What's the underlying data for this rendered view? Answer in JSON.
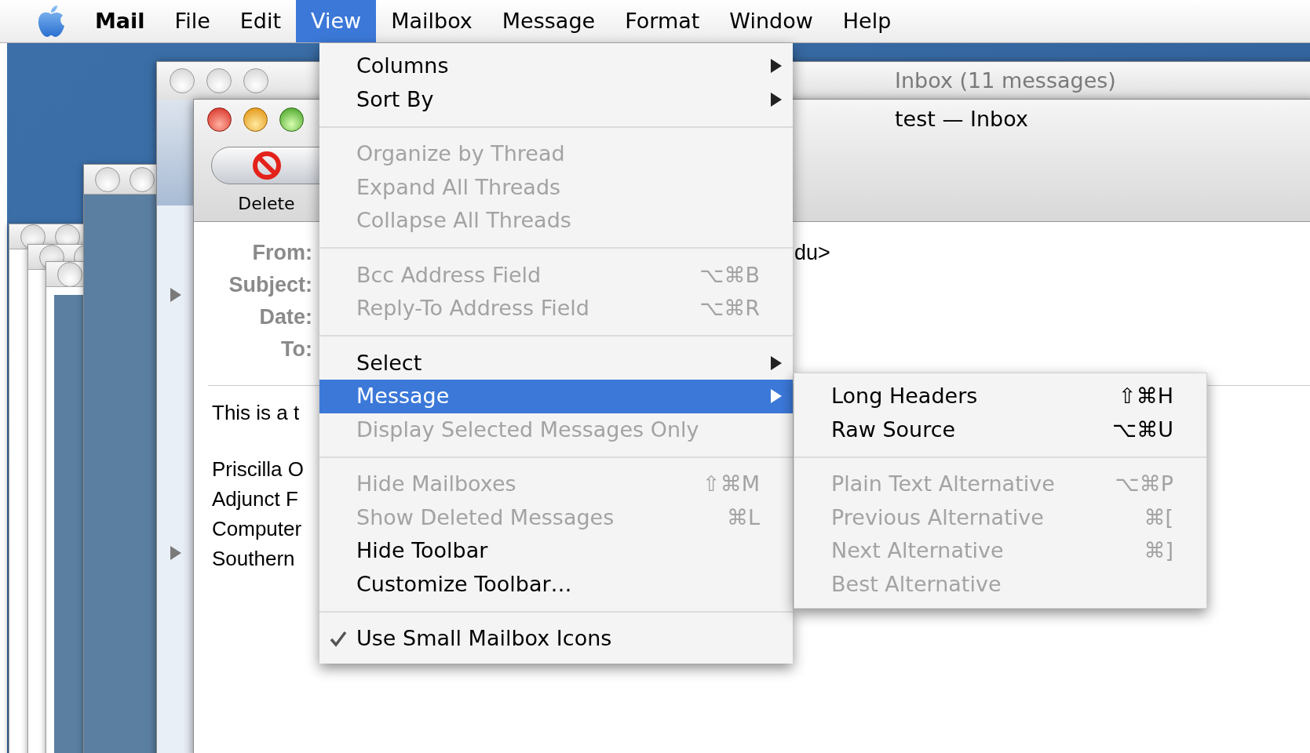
{
  "menu_bar": {
    "items": [
      {
        "label": "Mail",
        "bold": true,
        "selected": false
      },
      {
        "label": "File",
        "bold": false,
        "selected": false
      },
      {
        "label": "Edit",
        "bold": false,
        "selected": false
      },
      {
        "label": "View",
        "bold": false,
        "selected": true
      },
      {
        "label": "Mailbox",
        "bold": false,
        "selected": false
      },
      {
        "label": "Message",
        "bold": false,
        "selected": false
      },
      {
        "label": "Format",
        "bold": false,
        "selected": false
      },
      {
        "label": "Window",
        "bold": false,
        "selected": false
      },
      {
        "label": "Help",
        "bold": false,
        "selected": false
      }
    ]
  },
  "inbox_window": {
    "title": "Inbox (11 messages)"
  },
  "message_window": {
    "title": "test — Inbox",
    "toolbar": [
      {
        "label": "Delete"
      }
    ],
    "headers": [
      {
        "label": "From:",
        "value": "du>"
      },
      {
        "label": "Subject:"
      },
      {
        "label": "Date:"
      },
      {
        "label": "To:"
      }
    ],
    "body": [
      [
        "This is a t"
      ],
      [
        "Priscilla O",
        "Adjunct F",
        "Computer",
        "Southern"
      ]
    ]
  },
  "view_menu": {
    "items": [
      {
        "kind": "item",
        "label": "Columns",
        "disabled": false,
        "submenu": true,
        "checked": false,
        "selected": false
      },
      {
        "kind": "item",
        "label": "Sort By",
        "disabled": false,
        "submenu": true,
        "checked": false,
        "selected": false
      },
      {
        "kind": "separator"
      },
      {
        "kind": "item",
        "label": "Organize by Thread",
        "disabled": true,
        "submenu": false,
        "checked": false,
        "selected": false
      },
      {
        "kind": "item",
        "label": "Expand All Threads",
        "disabled": true,
        "submenu": false,
        "checked": false,
        "selected": false
      },
      {
        "kind": "item",
        "label": "Collapse All Threads",
        "disabled": true,
        "submenu": false,
        "checked": false,
        "selected": false
      },
      {
        "kind": "separator"
      },
      {
        "kind": "item",
        "label": "Bcc Address Field",
        "shortcut": "⌥⌘B",
        "disabled": true,
        "submenu": false,
        "checked": false,
        "selected": false
      },
      {
        "kind": "item",
        "label": "Reply-To Address Field",
        "shortcut": "⌥⌘R",
        "disabled": true,
        "submenu": false,
        "checked": false,
        "selected": false
      },
      {
        "kind": "separator"
      },
      {
        "kind": "item",
        "label": "Select",
        "disabled": false,
        "submenu": true,
        "checked": false,
        "selected": false
      },
      {
        "kind": "item",
        "label": "Message",
        "disabled": false,
        "submenu": true,
        "checked": false,
        "selected": true
      },
      {
        "kind": "item",
        "label": "Display Selected Messages Only",
        "disabled": true,
        "submenu": false,
        "checked": false,
        "selected": false
      },
      {
        "kind": "separator"
      },
      {
        "kind": "item",
        "label": "Hide Mailboxes",
        "shortcut": "⇧⌘M",
        "disabled": true,
        "submenu": false,
        "checked": false,
        "selected": false
      },
      {
        "kind": "item",
        "label": "Show Deleted Messages",
        "shortcut": "⌘L",
        "disabled": true,
        "submenu": false,
        "checked": false,
        "selected": false
      },
      {
        "kind": "item",
        "label": "Hide Toolbar",
        "disabled": false,
        "submenu": false,
        "checked": false,
        "selected": false
      },
      {
        "kind": "item",
        "label": "Customize Toolbar…",
        "disabled": false,
        "submenu": false,
        "checked": false,
        "selected": false
      },
      {
        "kind": "separator"
      },
      {
        "kind": "item",
        "label": "Use Small Mailbox Icons",
        "disabled": false,
        "submenu": false,
        "checked": true,
        "selected": false
      }
    ]
  },
  "message_submenu": {
    "items": [
      {
        "kind": "item",
        "label": "Long Headers",
        "shortcut": "⇧⌘H",
        "disabled": false,
        "selected": false
      },
      {
        "kind": "item",
        "label": "Raw Source",
        "shortcut": "⌥⌘U",
        "disabled": false,
        "selected": false
      },
      {
        "kind": "separator"
      },
      {
        "kind": "item",
        "label": "Plain Text Alternative",
        "shortcut": "⌥⌘P",
        "disabled": true,
        "selected": false
      },
      {
        "kind": "item",
        "label": "Previous Alternative",
        "shortcut": "⌘[",
        "disabled": true,
        "selected": false
      },
      {
        "kind": "item",
        "label": "Next Alternative",
        "shortcut": "⌘]",
        "disabled": true,
        "selected": false
      },
      {
        "kind": "item",
        "label": "Best Alternative",
        "disabled": true,
        "selected": false
      }
    ]
  }
}
